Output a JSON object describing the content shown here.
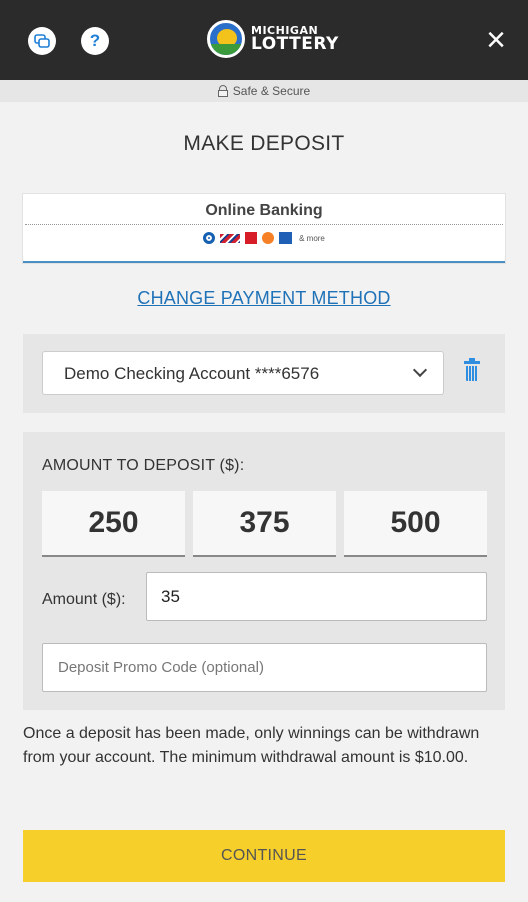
{
  "header": {
    "chat_icon": "chat-bubbles-icon",
    "help_label": "?",
    "logo_line1": "MICHIGAN",
    "logo_line2": "LOTTERY",
    "close_label": "×"
  },
  "secure": {
    "label": "Safe & Secure",
    "icon": "lock-icon"
  },
  "title": "MAKE DEPOSIT",
  "payment": {
    "method": "Online Banking",
    "bank_icons": [
      "chase-icon",
      "bank-of-america-icon",
      "wells-fargo-icon",
      "pnc-icon",
      "citi-icon"
    ],
    "more": "& more",
    "change_link": "CHANGE PAYMENT METHOD"
  },
  "account": {
    "selected": "Demo Checking Account ****6576",
    "delete_icon": "trash-icon"
  },
  "deposit": {
    "label": "AMOUNT TO DEPOSIT ($):",
    "presets": [
      "250",
      "375",
      "500"
    ],
    "amount_label": "Amount ($):",
    "amount_value": "35",
    "promo_placeholder": "Deposit Promo Code (optional)"
  },
  "notice": "Once a deposit has been made, only winnings can be withdrawn from your account. The minimum withdrawal amount is $10.00.",
  "continue_label": "CONTINUE",
  "colors": {
    "header_bg": "#2b2b2b",
    "accent": "#1f72b8",
    "continue_bg": "#f7cf2a",
    "trash": "#2f8ee0"
  }
}
